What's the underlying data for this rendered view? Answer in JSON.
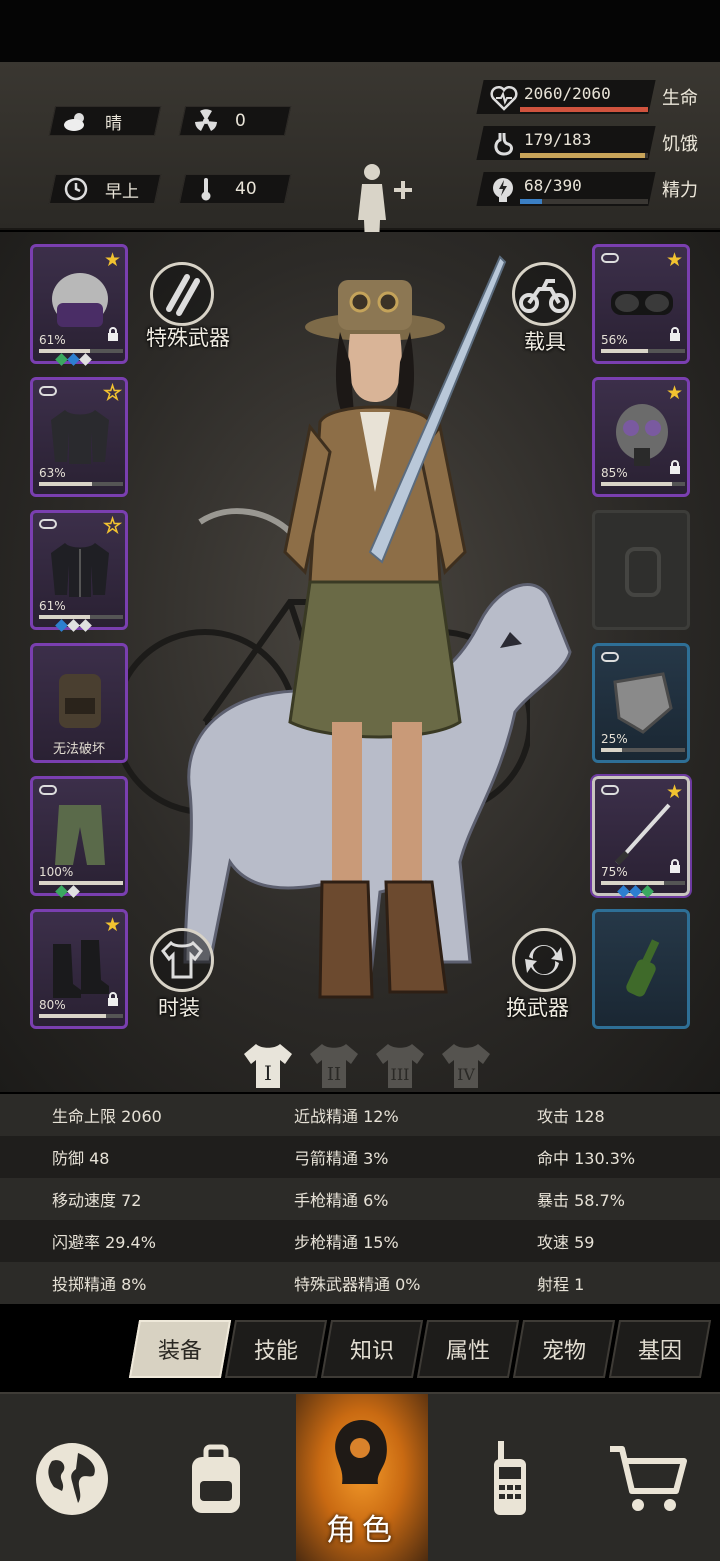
{
  "hud": {
    "weather": {
      "icon": "cloud-sun-icon",
      "label": "晴"
    },
    "radiation": {
      "icon": "radiation-icon",
      "value": "0"
    },
    "time_of_day": {
      "icon": "clock-icon",
      "label": "早上"
    },
    "temperature": {
      "icon": "thermometer-icon",
      "value": "40"
    },
    "health": {
      "value": "2060/2060",
      "label": "生命",
      "fraction": 1.0,
      "color": "#d0533e"
    },
    "hunger": {
      "value": "179/183",
      "label": "饥饿",
      "fraction": 0.978,
      "color": "#c9a55a"
    },
    "energy": {
      "value": "68/390",
      "label": "精力",
      "fraction": 0.174,
      "color": "#3b7fc4"
    }
  },
  "equipment": {
    "left": [
      {
        "slot": "helmet",
        "icon": "riot-helmet-icon",
        "durability": "61%",
        "fraction": 0.61,
        "star": "filled",
        "locked": true,
        "gems": [
          "#3aa860",
          "#2d7fd0",
          "#e0e0e0"
        ]
      },
      {
        "slot": "shirt",
        "icon": "sweater-icon",
        "durability": "63%",
        "fraction": 0.63,
        "star": "hollow",
        "linked": true
      },
      {
        "slot": "jacket",
        "icon": "jacket-icon",
        "durability": "61%",
        "fraction": 0.61,
        "star": "hollow",
        "linked": true,
        "gems": [
          "#2d7fd0",
          "#e0e0e0",
          "#e0e0e0"
        ]
      },
      {
        "slot": "backpack",
        "icon": "backpack-icon",
        "text": "无法破坏"
      },
      {
        "slot": "pants",
        "icon": "pants-icon",
        "durability": "100%",
        "fraction": 1.0,
        "linked": true,
        "gems": [
          "#3aa860",
          "#e0e0e0"
        ]
      },
      {
        "slot": "boots",
        "icon": "boots-icon",
        "durability": "80%",
        "fraction": 0.8,
        "star": "filled",
        "locked": true
      }
    ],
    "right": [
      {
        "slot": "goggles",
        "icon": "goggles-icon",
        "durability": "56%",
        "fraction": 0.56,
        "star": "filled",
        "locked": true,
        "linked": true
      },
      {
        "slot": "mask",
        "icon": "gas-mask-icon",
        "durability": "85%",
        "fraction": 0.85,
        "star": "filled",
        "locked": true
      },
      {
        "slot": "bag-empty",
        "icon": "empty-bag-icon"
      },
      {
        "slot": "shield",
        "icon": "shield-icon",
        "durability": "25%",
        "fraction": 0.25,
        "linked": true
      },
      {
        "slot": "weapon",
        "icon": "katana-icon",
        "durability": "75%",
        "fraction": 0.75,
        "star": "filled",
        "locked": true,
        "linked": true,
        "gems": [
          "#2d7fd0",
          "#2d7fd0",
          "#3aa860"
        ]
      },
      {
        "slot": "throwable",
        "icon": "molotov-icon"
      }
    ]
  },
  "actions": {
    "special_weapon": "特殊武器",
    "vehicle": "载具",
    "outfit": "时装",
    "switch_weapon": "换武器"
  },
  "outfit_tabs": [
    "I",
    "II",
    "III",
    "IV"
  ],
  "stats": [
    [
      "生命上限 2060",
      "近战精通 12%",
      "攻击 128"
    ],
    [
      "防御 48",
      "弓箭精通 3%",
      "命中 130.3%"
    ],
    [
      "移动速度 72",
      "手枪精通 6%",
      "暴击 58.7%"
    ],
    [
      "闪避率 29.4%",
      "步枪精通 15%",
      "攻速 59"
    ],
    [
      "投掷精通 8%",
      "特殊武器精通 0%",
      "射程 1"
    ]
  ],
  "subtabs": [
    "装备",
    "技能",
    "知识",
    "属性",
    "宠物",
    "基因"
  ],
  "nav": {
    "items": [
      {
        "icon": "globe-icon"
      },
      {
        "icon": "backpack-icon"
      },
      {
        "icon": "character-icon",
        "label": "角色"
      },
      {
        "icon": "radio-icon"
      },
      {
        "icon": "cart-icon"
      }
    ]
  }
}
